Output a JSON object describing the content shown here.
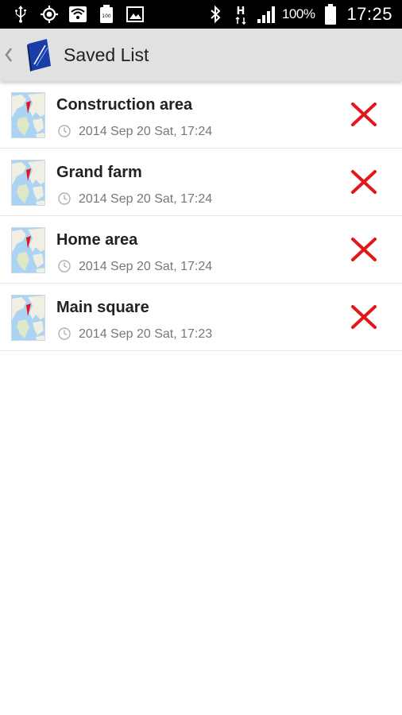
{
  "status_bar": {
    "battery_percent": "100%",
    "time": "17:25",
    "network_type": "H",
    "left_icons": [
      "usb-icon",
      "gps-icon",
      "wifi-icon",
      "battery-saver-icon",
      "gallery-icon"
    ],
    "right_icons": [
      "bluetooth-icon",
      "network-h-icon",
      "signal-icon",
      "battery-icon"
    ]
  },
  "action_bar": {
    "title": "Saved List",
    "back_icon": "chevron-left-icon",
    "logo_icon": "app-logo-icon"
  },
  "saved_items": [
    {
      "title": "Construction area",
      "date": "2014 Sep 20 Sat, 17:24"
    },
    {
      "title": "Grand farm",
      "date": "2014 Sep 20 Sat, 17:24"
    },
    {
      "title": "Home area",
      "date": "2014 Sep 20 Sat, 17:24"
    },
    {
      "title": "Main square",
      "date": "2014 Sep 20 Sat, 17:23"
    }
  ],
  "colors": {
    "status_bar": "#000000",
    "action_bar": "#e1e1e1",
    "delete": "#e3171b",
    "accent": "#1a3ea8"
  }
}
